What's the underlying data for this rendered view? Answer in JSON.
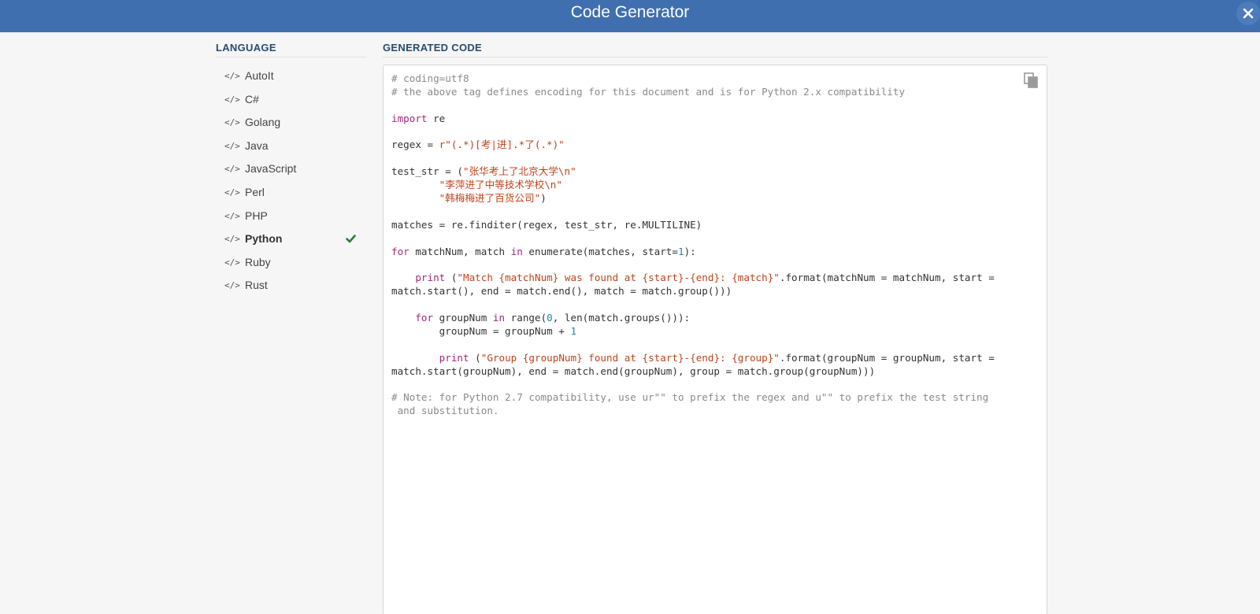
{
  "window": {
    "title": "Code Generator"
  },
  "sidebar": {
    "heading": "LANGUAGE",
    "items": [
      {
        "icon": "</>",
        "label": "AutoIt",
        "active": false
      },
      {
        "icon": "</>",
        "label": "C#",
        "active": false
      },
      {
        "icon": "</>",
        "label": "Golang",
        "active": false
      },
      {
        "icon": "</>",
        "label": "Java",
        "active": false
      },
      {
        "icon": "</>",
        "label": "JavaScript",
        "active": false
      },
      {
        "icon": "</>",
        "label": "Perl",
        "active": false
      },
      {
        "icon": "</>",
        "label": "PHP",
        "active": false
      },
      {
        "icon": "</>",
        "label": "Python",
        "active": true
      },
      {
        "icon": "</>",
        "label": "Ruby",
        "active": false
      },
      {
        "icon": "</>",
        "label": "Rust",
        "active": false
      }
    ]
  },
  "main": {
    "heading": "GENERATED CODE",
    "code_lines": [
      [
        {
          "t": "# coding=utf8",
          "c": "com"
        }
      ],
      [
        {
          "t": "# the above tag defines encoding for this document and is for Python 2.x compatibility",
          "c": "com"
        }
      ],
      [],
      [
        {
          "t": "import",
          "c": "kw"
        },
        {
          "t": " re",
          "c": ""
        }
      ],
      [],
      [
        {
          "t": "regex = ",
          "c": ""
        },
        {
          "t": "r\"(.*)[考|进].*了(.*)\"",
          "c": "str"
        }
      ],
      [],
      [
        {
          "t": "test_str = (",
          "c": ""
        },
        {
          "t": "\"张华考上了北京大学\\n\"",
          "c": "str"
        }
      ],
      [
        {
          "t": "        ",
          "c": ""
        },
        {
          "t": "\"李萍进了中等技术学校\\n\"",
          "c": "str"
        }
      ],
      [
        {
          "t": "        ",
          "c": ""
        },
        {
          "t": "\"韩梅梅进了百货公司\"",
          "c": "str"
        },
        {
          "t": ")",
          "c": ""
        }
      ],
      [],
      [
        {
          "t": "matches = re.finditer(regex, test_str, re.MULTILINE)",
          "c": ""
        }
      ],
      [],
      [
        {
          "t": "for",
          "c": "kw"
        },
        {
          "t": " matchNum, match ",
          "c": ""
        },
        {
          "t": "in",
          "c": "kw"
        },
        {
          "t": " enumerate(matches, start=",
          "c": ""
        },
        {
          "t": "1",
          "c": "num"
        },
        {
          "t": "):",
          "c": ""
        }
      ],
      [],
      [
        {
          "t": "    ",
          "c": ""
        },
        {
          "t": "print",
          "c": "kw"
        },
        {
          "t": " (",
          "c": ""
        },
        {
          "t": "\"Match {matchNum} was found at {start}-{end}: {match}\"",
          "c": "str"
        },
        {
          "t": ".format(matchNum = matchNum, start =",
          "c": ""
        }
      ],
      [
        {
          "t": "match.start(), end = match.end(), match = match.group()))",
          "c": ""
        }
      ],
      [],
      [
        {
          "t": "    ",
          "c": ""
        },
        {
          "t": "for",
          "c": "kw"
        },
        {
          "t": " groupNum ",
          "c": ""
        },
        {
          "t": "in",
          "c": "kw"
        },
        {
          "t": " range(",
          "c": ""
        },
        {
          "t": "0",
          "c": "num"
        },
        {
          "t": ", len(match.groups())):",
          "c": ""
        }
      ],
      [
        {
          "t": "        groupNum = groupNum + ",
          "c": ""
        },
        {
          "t": "1",
          "c": "num"
        }
      ],
      [],
      [
        {
          "t": "        ",
          "c": ""
        },
        {
          "t": "print",
          "c": "kw"
        },
        {
          "t": " (",
          "c": ""
        },
        {
          "t": "\"Group {groupNum} found at {start}-{end}: {group}\"",
          "c": "str"
        },
        {
          "t": ".format(groupNum = groupNum, start =",
          "c": ""
        }
      ],
      [
        {
          "t": "match.start(groupNum), end = match.end(groupNum), group = match.group(groupNum)))",
          "c": ""
        }
      ],
      [],
      [
        {
          "t": "# Note: for Python 2.7 compatibility, use ur\"\" to prefix the regex and u\"\" to prefix the test string",
          "c": "com"
        }
      ],
      [
        {
          "t": " and substitution.",
          "c": "com"
        }
      ]
    ]
  },
  "colors": {
    "header_bg": "#3f6fae",
    "keyword": "#a3287c",
    "string": "#c0441c",
    "number": "#1d84b5",
    "comment": "#8a8a8a",
    "check": "#2e7d32"
  },
  "icons": {
    "close": "close-icon",
    "copy": "copy-icon",
    "code": "code-icon",
    "check": "checkmark-icon"
  }
}
